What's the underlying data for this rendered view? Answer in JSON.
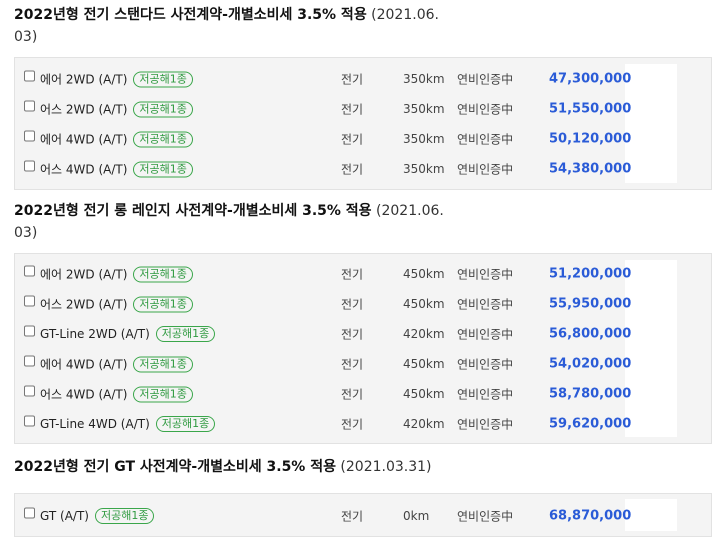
{
  "groups": [
    {
      "title": "2022년형 전기 스탠다드 사전계약-개별소비세 3.5% 적용",
      "date": "(2021.06.",
      "date2": "03)",
      "trims": [
        {
          "name": "에어 2WD (A/T)",
          "badge": "저공해1종",
          "fuel": "전기",
          "range": "350km",
          "efficiency": "연비인증中",
          "price": "47,300,000"
        },
        {
          "name": "어스 2WD (A/T)",
          "badge": "저공해1종",
          "fuel": "전기",
          "range": "350km",
          "efficiency": "연비인증中",
          "price": "51,550,000"
        },
        {
          "name": "에어 4WD (A/T)",
          "badge": "저공해1종",
          "fuel": "전기",
          "range": "350km",
          "efficiency": "연비인증中",
          "price": "50,120,000"
        },
        {
          "name": "어스 4WD (A/T)",
          "badge": "저공해1종",
          "fuel": "전기",
          "range": "350km",
          "efficiency": "연비인증中",
          "price": "54,380,000"
        }
      ]
    },
    {
      "title": "2022년형 전기 롱 레인지 사전계약-개별소비세 3.5% 적용",
      "date": "(2021.06.",
      "date2": "03)",
      "trims": [
        {
          "name": "에어 2WD (A/T)",
          "badge": "저공해1종",
          "fuel": "전기",
          "range": "450km",
          "efficiency": "연비인증中",
          "price": "51,200,000"
        },
        {
          "name": "어스 2WD (A/T)",
          "badge": "저공해1종",
          "fuel": "전기",
          "range": "450km",
          "efficiency": "연비인증中",
          "price": "55,950,000"
        },
        {
          "name": "GT-Line 2WD (A/T)",
          "badge": "저공해1종",
          "fuel": "전기",
          "range": "420km",
          "efficiency": "연비인증中",
          "price": "56,800,000"
        },
        {
          "name": "에어 4WD (A/T)",
          "badge": "저공해1종",
          "fuel": "전기",
          "range": "450km",
          "efficiency": "연비인증中",
          "price": "54,020,000"
        },
        {
          "name": "어스 4WD (A/T)",
          "badge": "저공해1종",
          "fuel": "전기",
          "range": "450km",
          "efficiency": "연비인증中",
          "price": "58,780,000"
        },
        {
          "name": "GT-Line 4WD (A/T)",
          "badge": "저공해1종",
          "fuel": "전기",
          "range": "420km",
          "efficiency": "연비인증中",
          "price": "59,620,000"
        }
      ]
    },
    {
      "title": "2022년형 전기 GT 사전계약-개별소비세 3.5% 적용",
      "date": "(2021.03.31)",
      "date2": "",
      "trims": [
        {
          "name": "GT (A/T)",
          "badge": "저공해1종",
          "fuel": "전기",
          "range": "0km",
          "efficiency": "연비인증中",
          "price": "68,870,000"
        }
      ]
    }
  ],
  "colors": {
    "price": "#2a5bd7",
    "badge": "#2f9a40",
    "panel": "#f4f4f4"
  }
}
